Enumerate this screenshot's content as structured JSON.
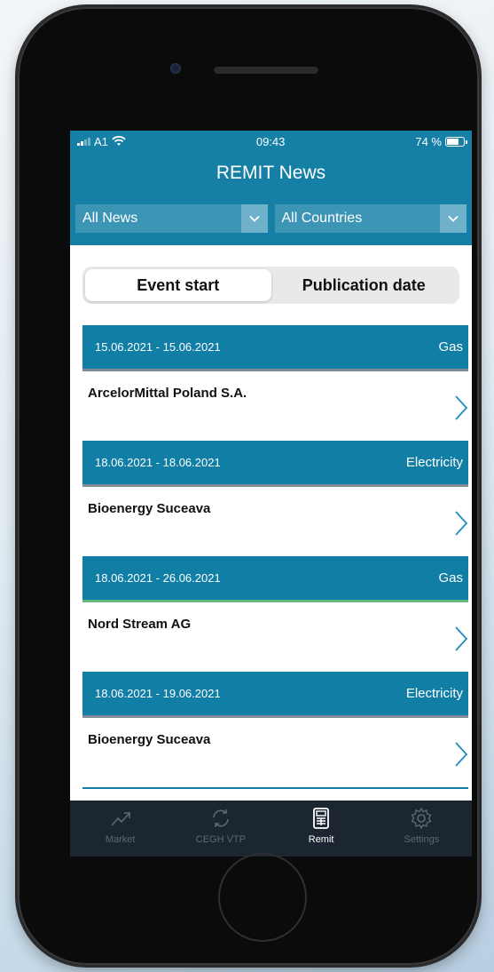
{
  "status": {
    "carrier": "A1",
    "time": "09:43",
    "battery": "74 %",
    "battery_level": 0.74
  },
  "header": {
    "title": "REMIT News"
  },
  "filters": {
    "news": "All News",
    "countries": "All Countries"
  },
  "segments": {
    "active": "Event start",
    "other": "Publication date"
  },
  "items": [
    {
      "dates": "15.06.2021 - 15.06.2021",
      "type": "Gas",
      "name": "ArcelorMittal Poland S.A."
    },
    {
      "dates": "18.06.2021 - 18.06.2021",
      "type": "Electricity",
      "name": "Bioenergy Suceava"
    },
    {
      "dates": "18.06.2021 - 26.06.2021",
      "type": "Gas",
      "name": "Nord Stream AG"
    },
    {
      "dates": "18.06.2021 - 19.06.2021",
      "type": "Electricity",
      "name": "Bioenergy Suceava"
    }
  ],
  "tabs": [
    {
      "label": "Market",
      "icon": "trend-icon"
    },
    {
      "label": "CEGH VTP",
      "icon": "sync-icon"
    },
    {
      "label": "Remit",
      "icon": "calculator-icon"
    },
    {
      "label": "Settings",
      "icon": "gear-icon"
    }
  ],
  "colors": {
    "primary": "#117ea6",
    "tabbar": "#1b2630",
    "accent_green": "#66b77a"
  }
}
